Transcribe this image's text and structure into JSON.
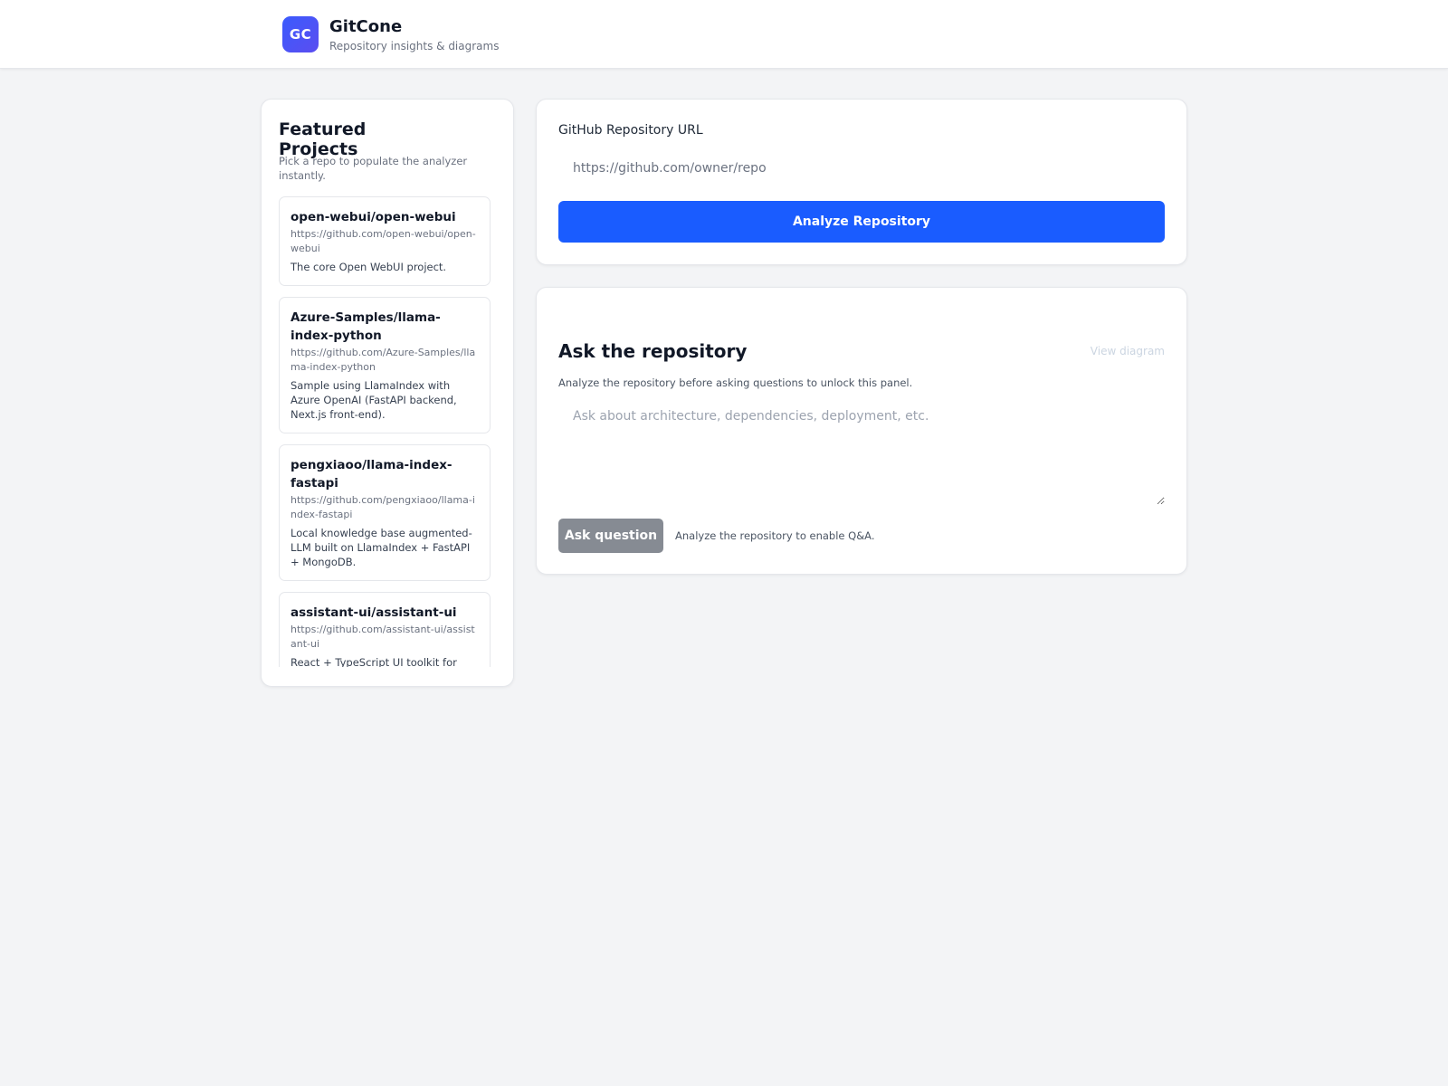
{
  "header": {
    "logo_text": "GC",
    "app_name": "GitCone",
    "tagline": "Repository insights & diagrams"
  },
  "featured": {
    "title": "Featured Projects",
    "subtitle": "Pick a repo to populate the analyzer instantly.",
    "projects": [
      {
        "name": "open-webui/open-webui",
        "url": "https://github.com/open-webui/open-webui",
        "description": "The core Open WebUI project."
      },
      {
        "name": "Azure-Samples/llama-index-python",
        "url": "https://github.com/Azure-Samples/llama-index-python",
        "description": "Sample using LlamaIndex with Azure OpenAI (FastAPI backend, Next.js front-end)."
      },
      {
        "name": "pengxiaoo/llama-index-fastapi",
        "url": "https://github.com/pengxiaoo/llama-index-fastapi",
        "description": "Local knowledge base augmented-LLM built on LlamaIndex + FastAPI + MongoDB."
      },
      {
        "name": "assistant-ui/assistant-ui",
        "url": "https://github.com/assistant-ui/assistant-ui",
        "description": "React + TypeScript UI toolkit for building AI chat experiences."
      }
    ]
  },
  "analyzer": {
    "url_label": "GitHub Repository URL",
    "url_value": "",
    "url_placeholder": "https://github.com/owner/repo",
    "analyze_button": "Analyze Repository"
  },
  "ask": {
    "title": "Ask the repository",
    "view_diagram_link": "View diagram",
    "subtitle": "Analyze the repository before asking questions to unlock this panel.",
    "question_value": "",
    "question_placeholder": "Ask about architecture, dependencies, deployment, etc.",
    "ask_button": "Ask question",
    "hint": "Analyze the repository to enable Q&A."
  },
  "colors": {
    "primary": "#1a5cff",
    "logo_gradient_start": "#3b5bfd",
    "logo_gradient_end": "#5b4df0",
    "disabled_button": "#868b93",
    "page_background": "#f3f4f6"
  }
}
